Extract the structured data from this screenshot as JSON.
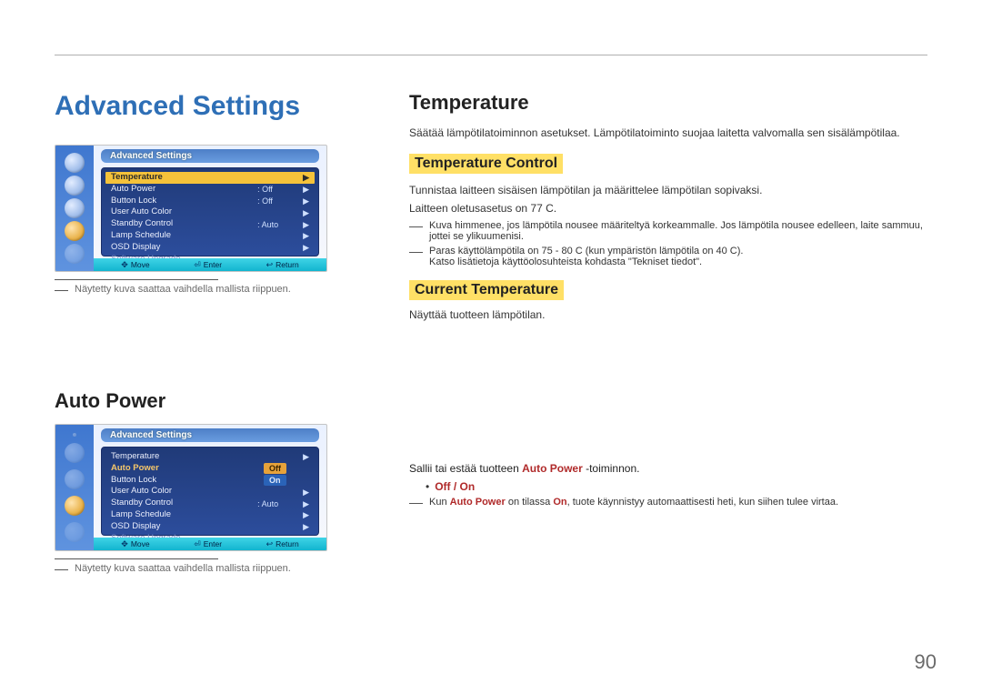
{
  "page_number": "90",
  "heading_main": "Advanced Settings",
  "figure_note_1": "Näytetty kuva saattaa vaihdella mallista riippuen.",
  "heading_autopower": "Auto Power",
  "figure_note_2": "Näytetty kuva saattaa vaihdella mallista riippuen.",
  "osd1": {
    "title": "Advanced Settings",
    "rows": [
      {
        "label": "Temperature",
        "value": "",
        "hl": true
      },
      {
        "label": "Auto Power",
        "value": "Off"
      },
      {
        "label": "Button Lock",
        "value": "Off"
      },
      {
        "label": "User Auto Color",
        "value": ""
      },
      {
        "label": "Standby Control",
        "value": "Auto"
      },
      {
        "label": "Lamp Schedule",
        "value": ""
      },
      {
        "label": "OSD Display",
        "value": ""
      },
      {
        "label": "Software Upgrade",
        "value": "",
        "dim": true
      }
    ],
    "nav_move": "Move",
    "nav_enter": "Enter",
    "nav_return": "Return"
  },
  "osd2": {
    "title": "Advanced Settings",
    "rows": [
      {
        "label": "Temperature",
        "value": ""
      },
      {
        "label": "Auto Power",
        "value_opt": "Off",
        "sel": true,
        "opt_off": true
      },
      {
        "label": "Button Lock",
        "value_opt": "On",
        "opt_on": true
      },
      {
        "label": "User Auto Color",
        "value": ""
      },
      {
        "label": "Standby Control",
        "value": "Auto"
      },
      {
        "label": "Lamp Schedule",
        "value": ""
      },
      {
        "label": "OSD Display",
        "value": ""
      },
      {
        "label": "Software Upgrade",
        "value": "",
        "dim": true
      }
    ],
    "nav_move": "Move",
    "nav_enter": "Enter",
    "nav_return": "Return"
  },
  "temperature": {
    "heading": "Temperature",
    "intro": "Säätää lämpötilatoiminnon asetukset. Lämpötilatoiminto suojaa laitetta valvomalla sen sisälämpötilaa.",
    "control_heading": "Temperature Control",
    "control_p1": "Tunnistaa laitteen sisäisen lämpötilan ja määrittelee lämpötilan sopivaksi.",
    "control_p2": "Laitteen oletusasetus on 77 C.",
    "control_note1": "Kuva himmenee, jos lämpötila nousee määriteltyä korkeammalle. Jos lämpötila nousee edelleen, laite sammuu, jottei se ylikuumenisi.",
    "control_note2a": "Paras käyttölämpötila on 75 - 80 C (kun ympäristön lämpötila on 40 C).",
    "control_note2b": "Katso lisätietoja käyttöolosuhteista kohdasta \"Tekniset tiedot\".",
    "current_heading": "Current Temperature",
    "current_p": "Näyttää tuotteen lämpötilan."
  },
  "autopower": {
    "intro_pre": "Sallii tai estää tuotteen ",
    "intro_term": "Auto Power",
    "intro_post": " -toiminnon.",
    "option_label": "Off / On",
    "note_pre": "Kun ",
    "note_term": "Auto Power",
    "note_mid": " on tilassa ",
    "note_on": "On",
    "note_post": ", tuote käynnistyy automaattisesti heti, kun siihen tulee virtaa."
  }
}
